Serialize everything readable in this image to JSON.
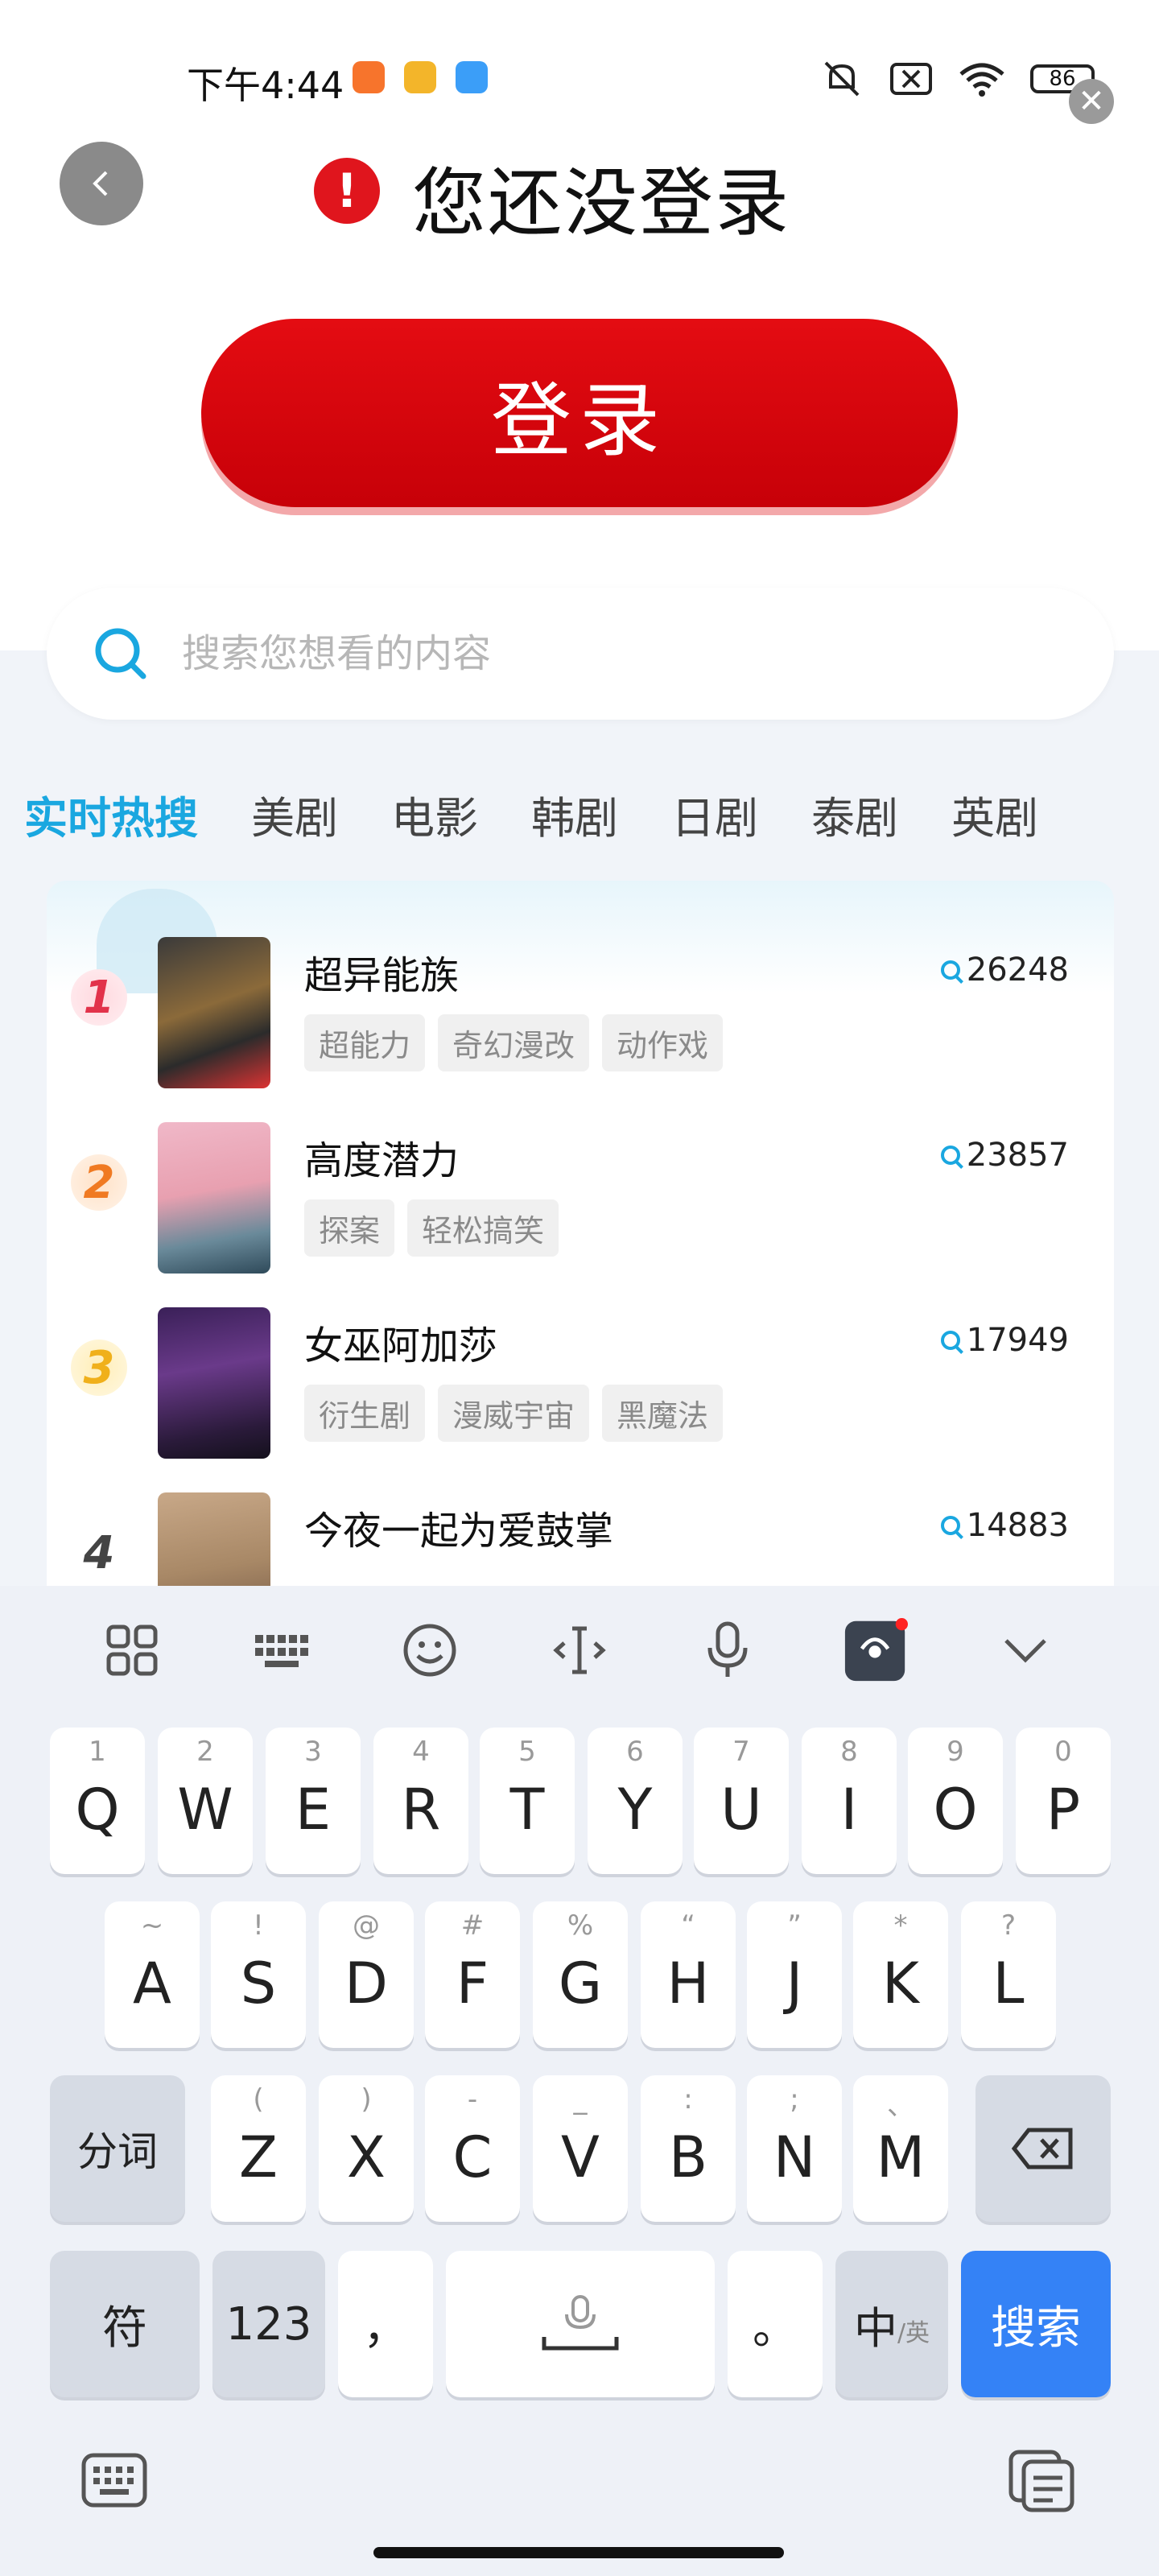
{
  "status_bar": {
    "time": "下午4:44",
    "battery": "86",
    "app_icon_colors": [
      "#f7742c",
      "#f3b52a",
      "#3b9ef8"
    ],
    "icons": [
      "mute-icon",
      "no-sim-icon",
      "wifi-icon",
      "battery-icon"
    ]
  },
  "login_panel": {
    "alert_text": "您还没登录",
    "alert_mark": "!",
    "login_button": "登录",
    "close_glyph": "✕"
  },
  "search": {
    "placeholder": "搜索您想看的内容"
  },
  "tabs": [
    "实时热搜",
    "美剧",
    "电影",
    "韩剧",
    "日剧",
    "泰剧",
    "英剧"
  ],
  "ranking": [
    {
      "rank": "1",
      "title": "超异能族",
      "count": "26248",
      "tags": [
        "超能力",
        "奇幻漫改",
        "动作戏"
      ]
    },
    {
      "rank": "2",
      "title": "高度潜力",
      "count": "23857",
      "tags": [
        "探案",
        "轻松搞笑"
      ]
    },
    {
      "rank": "3",
      "title": "女巫阿加莎",
      "count": "17949",
      "tags": [
        "衍生剧",
        "漫威宇宙",
        "黑魔法"
      ]
    },
    {
      "rank": "4",
      "title": "今夜一起为爱鼓掌",
      "count": "14883",
      "tags": []
    }
  ],
  "keyboard": {
    "row1": [
      {
        "main": "Q",
        "sub": "1"
      },
      {
        "main": "W",
        "sub": "2"
      },
      {
        "main": "E",
        "sub": "3"
      },
      {
        "main": "R",
        "sub": "4"
      },
      {
        "main": "T",
        "sub": "5"
      },
      {
        "main": "Y",
        "sub": "6"
      },
      {
        "main": "U",
        "sub": "7"
      },
      {
        "main": "I",
        "sub": "8"
      },
      {
        "main": "O",
        "sub": "9"
      },
      {
        "main": "P",
        "sub": "0"
      }
    ],
    "row2": [
      {
        "main": "A",
        "sub": "~"
      },
      {
        "main": "S",
        "sub": "!"
      },
      {
        "main": "D",
        "sub": "@"
      },
      {
        "main": "F",
        "sub": "#"
      },
      {
        "main": "G",
        "sub": "%"
      },
      {
        "main": "H",
        "sub": "“"
      },
      {
        "main": "J",
        "sub": "”"
      },
      {
        "main": "K",
        "sub": "*"
      },
      {
        "main": "L",
        "sub": "?"
      }
    ],
    "row3": [
      {
        "main": "Z",
        "sub": "("
      },
      {
        "main": "X",
        "sub": ")"
      },
      {
        "main": "C",
        "sub": "-"
      },
      {
        "main": "V",
        "sub": "_"
      },
      {
        "main": "B",
        "sub": ":"
      },
      {
        "main": "N",
        "sub": ";"
      },
      {
        "main": "M",
        "sub": "、"
      }
    ],
    "segment_key": "分词",
    "symbol_key": "符",
    "number_key": "123",
    "comma_key": "，",
    "period_key": "。",
    "lang_key_main": "中",
    "lang_key_sub": "/英",
    "search_key": "搜索"
  },
  "colors": {
    "login_red": "#e0151d",
    "accent_blue": "#1aa7e0",
    "search_key_blue": "#3482f6"
  }
}
